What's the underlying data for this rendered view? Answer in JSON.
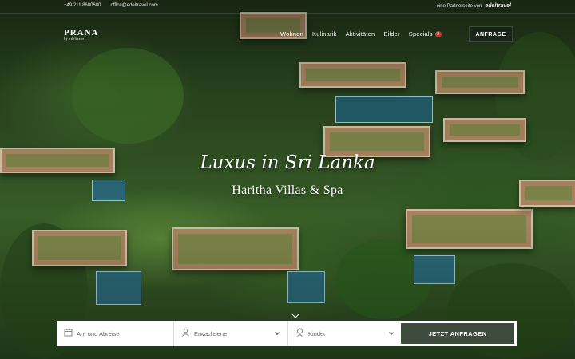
{
  "topbar": {
    "phone": "+49 211 8680680",
    "email": "office@edeltravel.com",
    "partner_text": "eine Partnerseite von",
    "partner_logo": "edeltravel"
  },
  "logo": {
    "name": "PRANA",
    "sub": "by edeltravel"
  },
  "nav": {
    "items": [
      "Wohnen",
      "Kulinarik",
      "Aktivitäten",
      "Bilder",
      "Specials"
    ],
    "specials_badge": "2",
    "cta": "ANFRAGE"
  },
  "hero": {
    "script_title": "Luxus in Sri Lanka",
    "subtitle": "Haritha Villas & Spa"
  },
  "booking": {
    "dates_placeholder": "An- und Abreise",
    "adults_label": "Erwachsene",
    "children_label": "Kinder",
    "submit_label": "JETZT ANFRAGEN"
  },
  "colors": {
    "cta_dark": "#3e4a3c",
    "badge": "#c0392b"
  }
}
